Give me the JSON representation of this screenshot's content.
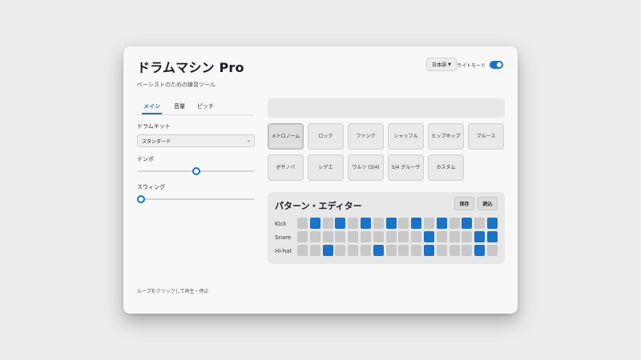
{
  "app": {
    "title": "ドラムマシン Pro",
    "subtitle": "ベーシストのための練習ツール",
    "language": "日本語",
    "theme_label": "ライトモード",
    "theme_toggle_on": true
  },
  "tabs": [
    {
      "label": "メイン",
      "active": true
    },
    {
      "label": "音量",
      "active": false
    },
    {
      "label": "ピッチ",
      "active": false
    }
  ],
  "settings": {
    "drumkit_label": "ドラムキット",
    "drumkit_value": "スタンダード",
    "tempo_label": "テンポ",
    "tempo_level": 0.5,
    "swing_label": "スウィング",
    "swing_level": 0.0
  },
  "footer_hint": "ループをクリックして再生・停止",
  "presets": [
    {
      "label": "メトロノーム",
      "active": true
    },
    {
      "label": "ロック",
      "active": false
    },
    {
      "label": "ファンク",
      "active": false
    },
    {
      "label": "シャッフル",
      "active": false
    },
    {
      "label": "ヒップホップ",
      "active": false
    },
    {
      "label": "ブルース",
      "active": false
    },
    {
      "label": "ボサノバ",
      "active": false
    },
    {
      "label": "レゲエ",
      "active": false
    },
    {
      "label": "ワルツ (3/4)",
      "active": false
    },
    {
      "label": "5/4 グルーヴ",
      "active": false
    },
    {
      "label": "カスタム",
      "active": false
    }
  ],
  "pattern": {
    "title": "パターン・エディター",
    "save_label": "保存",
    "load_label": "読込",
    "rows": [
      {
        "name": "Kick",
        "steps": [
          0,
          1,
          0,
          1,
          0,
          1,
          0,
          1,
          0,
          1,
          0,
          1,
          0,
          1,
          0,
          1
        ]
      },
      {
        "name": "Snare",
        "steps": [
          0,
          0,
          0,
          0,
          0,
          0,
          0,
          0,
          0,
          0,
          1,
          0,
          0,
          0,
          1,
          1
        ]
      },
      {
        "name": "Hi-hat",
        "steps": [
          0,
          0,
          1,
          0,
          0,
          0,
          1,
          0,
          0,
          0,
          1,
          0,
          0,
          0,
          1,
          0
        ]
      }
    ]
  },
  "colors": {
    "accent": "#1a73c8",
    "step_off": "#c8c8c8",
    "card": "#f8f8f8",
    "background": "#ececec"
  }
}
